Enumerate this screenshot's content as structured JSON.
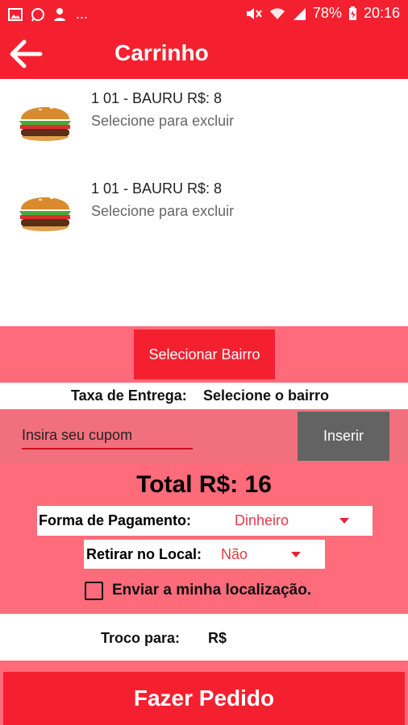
{
  "status_bar": {
    "battery": "78%",
    "time": "20:16",
    "more": "..."
  },
  "appbar": {
    "title": "Carrinho"
  },
  "cart": {
    "items": [
      {
        "name": "1 01 - BAURU R$: 8",
        "hint": "Selecione para excluir",
        "icon": "burger-image"
      },
      {
        "name": "1 01 - BAURU R$: 8",
        "hint": "Selecione para excluir",
        "icon": "burger-image"
      }
    ]
  },
  "delivery": {
    "select_neighborhood_label": "Selecionar Bairro",
    "fee_label": "Taxa de Entrega:",
    "fee_value": "Selecione o bairro"
  },
  "coupon": {
    "placeholder": "Insira seu cupom",
    "insert_label": "Inserir"
  },
  "total": {
    "text": "Total R$: 16"
  },
  "payment": {
    "label": "Forma de Pagamento:",
    "selected": "Dinheiro"
  },
  "pickup": {
    "label": "Retirar no Local:",
    "selected": "Não"
  },
  "location": {
    "label": "Enviar a minha localização.",
    "checked": false
  },
  "change": {
    "label": "Troco para:",
    "currency": "R$"
  },
  "order_button": {
    "label": "Fazer Pedido"
  },
  "colors": {
    "primary": "#f5202f",
    "panel": "#fe6b7a",
    "gray_button": "#636363"
  }
}
